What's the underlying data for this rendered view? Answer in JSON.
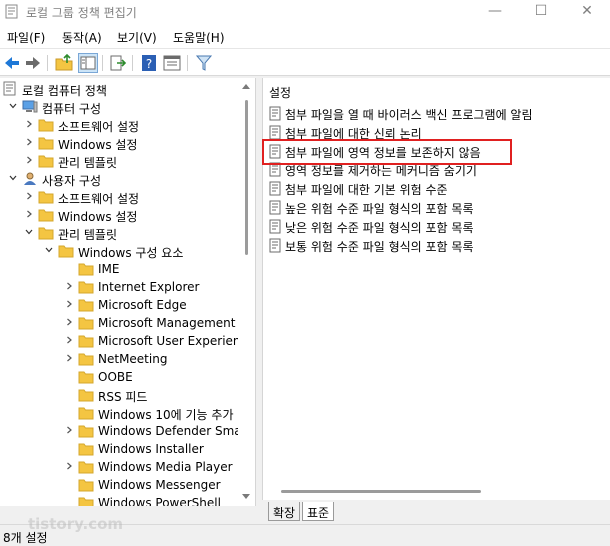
{
  "window": {
    "title": "로컬 그룹 정책 편집기",
    "minimize_glyph": "—",
    "maximize_glyph": "☐",
    "close_glyph": "✕"
  },
  "menu": {
    "items": [
      {
        "label": "파일(F)"
      },
      {
        "label": "동작(A)"
      },
      {
        "label": "보기(V)"
      },
      {
        "label": "도움말(H)"
      }
    ]
  },
  "toolbar": {
    "buttons": [
      "back-icon",
      "forward-icon",
      "up-folder-icon",
      "show-hide-tree-icon",
      "export-list-icon",
      "help-icon",
      "properties-icon",
      "filter-icon"
    ]
  },
  "tree": {
    "items": [
      {
        "label": "로컬 컴퓨터 정책",
        "level": 0,
        "expander": "none",
        "icon": "policy-icon"
      },
      {
        "label": "컴퓨터 구성",
        "level": 1,
        "expander": "expanded",
        "icon": "computer-icon"
      },
      {
        "label": "소프트웨어 설정",
        "level": 2,
        "expander": "collapsed",
        "icon": "folder-icon"
      },
      {
        "label": "Windows 설정",
        "level": 2,
        "expander": "collapsed",
        "icon": "folder-icon"
      },
      {
        "label": "관리 템플릿",
        "level": 2,
        "expander": "collapsed",
        "icon": "folder-icon"
      },
      {
        "label": "사용자 구성",
        "level": 1,
        "expander": "expanded",
        "icon": "user-icon"
      },
      {
        "label": "소프트웨어 설정",
        "level": 2,
        "expander": "collapsed",
        "icon": "folder-icon"
      },
      {
        "label": "Windows 설정",
        "level": 2,
        "expander": "collapsed",
        "icon": "folder-icon"
      },
      {
        "label": "관리 템플릿",
        "level": 2,
        "expander": "expanded",
        "icon": "folder-icon"
      },
      {
        "label": "Windows 구성 요소",
        "level": 3,
        "expander": "expanded",
        "icon": "folder-icon"
      },
      {
        "label": "IME",
        "level": 4,
        "expander": "none",
        "icon": "folder-icon"
      },
      {
        "label": "Internet Explorer",
        "level": 4,
        "expander": "collapsed",
        "icon": "folder-icon"
      },
      {
        "label": "Microsoft Edge",
        "level": 4,
        "expander": "collapsed",
        "icon": "folder-icon"
      },
      {
        "label": "Microsoft Management C",
        "level": 4,
        "expander": "collapsed",
        "icon": "folder-icon"
      },
      {
        "label": "Microsoft User Experience",
        "level": 4,
        "expander": "collapsed",
        "icon": "folder-icon"
      },
      {
        "label": "NetMeeting",
        "level": 4,
        "expander": "collapsed",
        "icon": "folder-icon"
      },
      {
        "label": "OOBE",
        "level": 4,
        "expander": "none",
        "icon": "folder-icon"
      },
      {
        "label": "RSS 피드",
        "level": 4,
        "expander": "none",
        "icon": "folder-icon"
      },
      {
        "label": "Windows 10에 기능 추가",
        "level": 4,
        "expander": "none",
        "icon": "folder-icon"
      },
      {
        "label": "Windows Defender Smart",
        "level": 4,
        "expander": "collapsed",
        "icon": "folder-icon"
      },
      {
        "label": "Windows Installer",
        "level": 4,
        "expander": "none",
        "icon": "folder-icon"
      },
      {
        "label": "Windows Media Player",
        "level": 4,
        "expander": "collapsed",
        "icon": "folder-icon"
      },
      {
        "label": "Windows Messenger",
        "level": 4,
        "expander": "none",
        "icon": "folder-icon"
      },
      {
        "label": "Windows PowerShell",
        "level": 4,
        "expander": "none",
        "icon": "folder-icon"
      }
    ]
  },
  "settings": {
    "header": "설정",
    "items": [
      {
        "label": "첨부 파일을 열 때 바이러스 백신 프로그램에 알림"
      },
      {
        "label": "첨부 파일에 대한 신뢰 논리"
      },
      {
        "label": "첨부 파일에 영역 정보를 보존하지 않음",
        "highlighted": true
      },
      {
        "label": "영역 정보를 제거하는 메커니즘 숨기기"
      },
      {
        "label": "첨부 파일에 대한 기본 위험 수준"
      },
      {
        "label": "높은 위험 수준 파일 형식의 포함 목록"
      },
      {
        "label": "낮은 위험 수준 파일 형식의 포함 목록"
      },
      {
        "label": "보통 위험 수준 파일 형식의 포함 목록"
      }
    ],
    "highlight_color": "#e02020"
  },
  "tabs": [
    {
      "label": "확장"
    },
    {
      "label": "표준",
      "active": true
    }
  ],
  "status": {
    "text": "8개 설정"
  },
  "watermark": "tistory.com",
  "colors": {
    "folder": "#f4c542",
    "accent": "#1e78d7"
  }
}
